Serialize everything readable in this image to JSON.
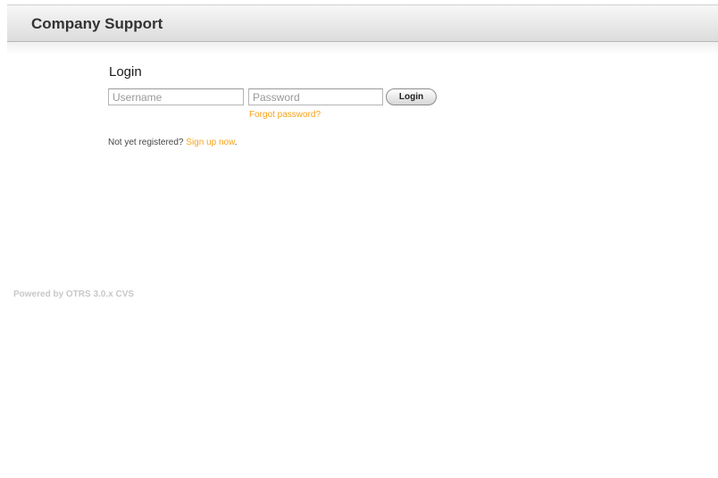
{
  "header": {
    "title": "Company Support"
  },
  "login": {
    "heading": "Login",
    "username_placeholder": "Username",
    "password_placeholder": "Password",
    "button_label": "Login",
    "forgot_password": "Forgot password?"
  },
  "register": {
    "prompt": "Not yet registered?",
    "link": "Sign up now",
    "trailing": "."
  },
  "footer": {
    "powered_by": "Powered by OTRS 3.0.x CVS"
  },
  "colors": {
    "accent": "#f5a21b"
  }
}
